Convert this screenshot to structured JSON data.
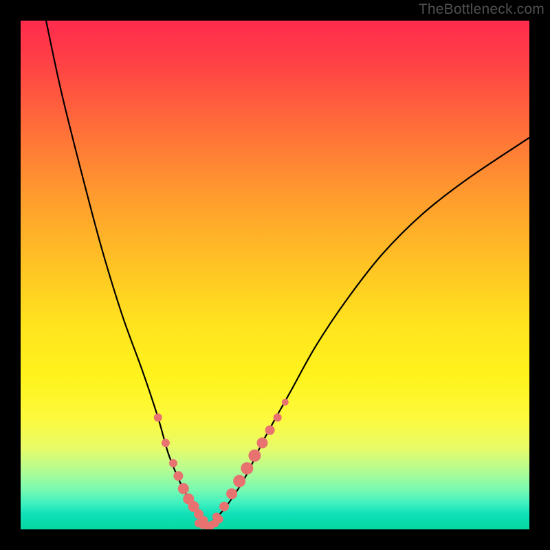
{
  "watermark": "TheBottleneck.com",
  "colors": {
    "frame": "#000000",
    "curve": "#000000",
    "markers": "#e8726f",
    "gradient_stops": [
      {
        "pos": 0.0,
        "color": "#ff2b4d"
      },
      {
        "pos": 0.08,
        "color": "#ff4046"
      },
      {
        "pos": 0.2,
        "color": "#ff6a3a"
      },
      {
        "pos": 0.34,
        "color": "#ff9a2e"
      },
      {
        "pos": 0.48,
        "color": "#ffc324"
      },
      {
        "pos": 0.6,
        "color": "#ffe41e"
      },
      {
        "pos": 0.7,
        "color": "#fff31c"
      },
      {
        "pos": 0.78,
        "color": "#fdfa3c"
      },
      {
        "pos": 0.84,
        "color": "#e8fb68"
      },
      {
        "pos": 0.88,
        "color": "#b8fc8f"
      },
      {
        "pos": 0.92,
        "color": "#7cfab0"
      },
      {
        "pos": 0.95,
        "color": "#3cf0c0"
      },
      {
        "pos": 0.97,
        "color": "#10e0b8"
      },
      {
        "pos": 1.0,
        "color": "#06d8a0"
      }
    ]
  },
  "chart_data": {
    "type": "line",
    "title": "",
    "xlabel": "",
    "ylabel": "",
    "xlim": [
      0,
      100
    ],
    "ylim": [
      0,
      100
    ],
    "curve_left": {
      "x": [
        5,
        8,
        12,
        16,
        20,
        24,
        27,
        29,
        31,
        33,
        35,
        37
      ],
      "y": [
        100,
        86,
        70,
        55,
        42,
        31,
        22,
        15,
        10,
        6,
        3,
        1
      ]
    },
    "curve_right": {
      "x": [
        37,
        40,
        44,
        48,
        53,
        58,
        64,
        71,
        79,
        88,
        100
      ],
      "y": [
        1,
        4,
        10,
        18,
        27,
        36,
        45,
        54,
        62,
        69,
        77
      ]
    },
    "markers_left": {
      "x": [
        27.0,
        28.5,
        30.0,
        31.0,
        32.0,
        33.0,
        34.0,
        35.0,
        36.0
      ],
      "y": [
        22.0,
        17.0,
        13.0,
        10.5,
        8.0,
        6.0,
        4.5,
        3.0,
        1.8
      ],
      "r": [
        6,
        6,
        6,
        7,
        8,
        8,
        8,
        7,
        6
      ]
    },
    "markers_right": {
      "x": [
        38.5,
        40.0,
        41.5,
        43.0,
        44.5,
        46.0,
        47.5,
        49.0,
        50.5,
        52.0
      ],
      "y": [
        2.5,
        4.5,
        7.0,
        9.5,
        12.0,
        14.5,
        17.0,
        19.5,
        22.0,
        25.0
      ],
      "r": [
        6,
        7,
        8,
        9,
        9,
        9,
        8,
        7,
        6,
        5
      ]
    },
    "bottom": {
      "x": [
        35.0,
        35.8,
        36.6,
        37.4,
        38.2,
        39.0
      ],
      "y": [
        1.2,
        0.9,
        0.8,
        0.8,
        1.2,
        2.0
      ],
      "r": [
        6,
        6,
        6,
        6,
        6,
        6
      ]
    }
  }
}
